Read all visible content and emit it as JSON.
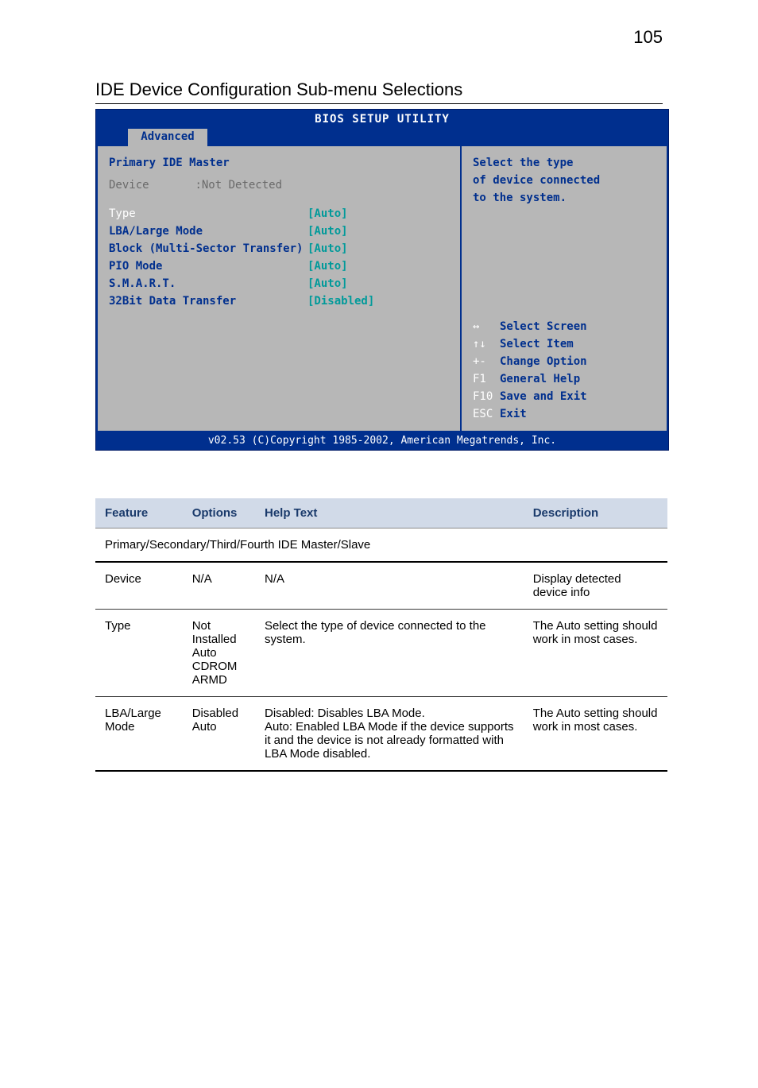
{
  "page_number": "105",
  "section_title": "IDE Device Configuration Sub-menu Selections",
  "bios": {
    "title": "BIOS SETUP UTILITY",
    "tab": "Advanced",
    "left": {
      "heading": "Primary IDE Master",
      "device_label": "Device",
      "device_value": ":Not Detected",
      "rows": [
        {
          "label": "Type",
          "value": "[Auto]",
          "highlight": true
        },
        {
          "label": "LBA/Large Mode",
          "value": "[Auto]"
        },
        {
          "label": "Block (Multi-Sector Transfer)",
          "value": "[Auto]"
        },
        {
          "label": "PIO Mode",
          "value": "[Auto]"
        },
        {
          "label": "S.M.A.R.T.",
          "value": "[Auto]"
        },
        {
          "label": "32Bit Data Transfer",
          "value": "[Disabled]"
        }
      ]
    },
    "right": {
      "help_text": "Select the type\nof device connected\nto the system.",
      "keys": [
        {
          "k": "↔",
          "t": "Select Screen"
        },
        {
          "k": "↑↓",
          "t": "Select Item"
        },
        {
          "k": "+-",
          "t": "Change Option"
        },
        {
          "k": "F1",
          "t": "General Help"
        },
        {
          "k": "F10",
          "t": "Save and Exit"
        },
        {
          "k": "ESC",
          "t": "Exit"
        }
      ]
    },
    "footer": "v02.53 (C)Copyright 1985-2002, American Megatrends, Inc."
  },
  "table": {
    "headers": [
      "Feature",
      "Options",
      "Help Text",
      "Description"
    ],
    "group_row": "Primary/Secondary/Third/Fourth IDE Master/Slave",
    "rows": [
      {
        "feature": "Device",
        "options": "N/A",
        "help": "N/A",
        "desc": "Display detected device info"
      },
      {
        "feature": "Type",
        "options": "Not Installed\nAuto\nCDROM\nARMD",
        "help": "Select the type of device connected to the system.",
        "desc": "The Auto setting should work in most cases."
      },
      {
        "feature": "LBA/Large Mode",
        "options": "Disabled\nAuto",
        "help": "Disabled:  Disables LBA Mode.\nAuto:  Enabled LBA Mode if the device supports it and the device is not already formatted with LBA Mode disabled.",
        "desc": "The Auto setting should work in most cases."
      }
    ]
  }
}
